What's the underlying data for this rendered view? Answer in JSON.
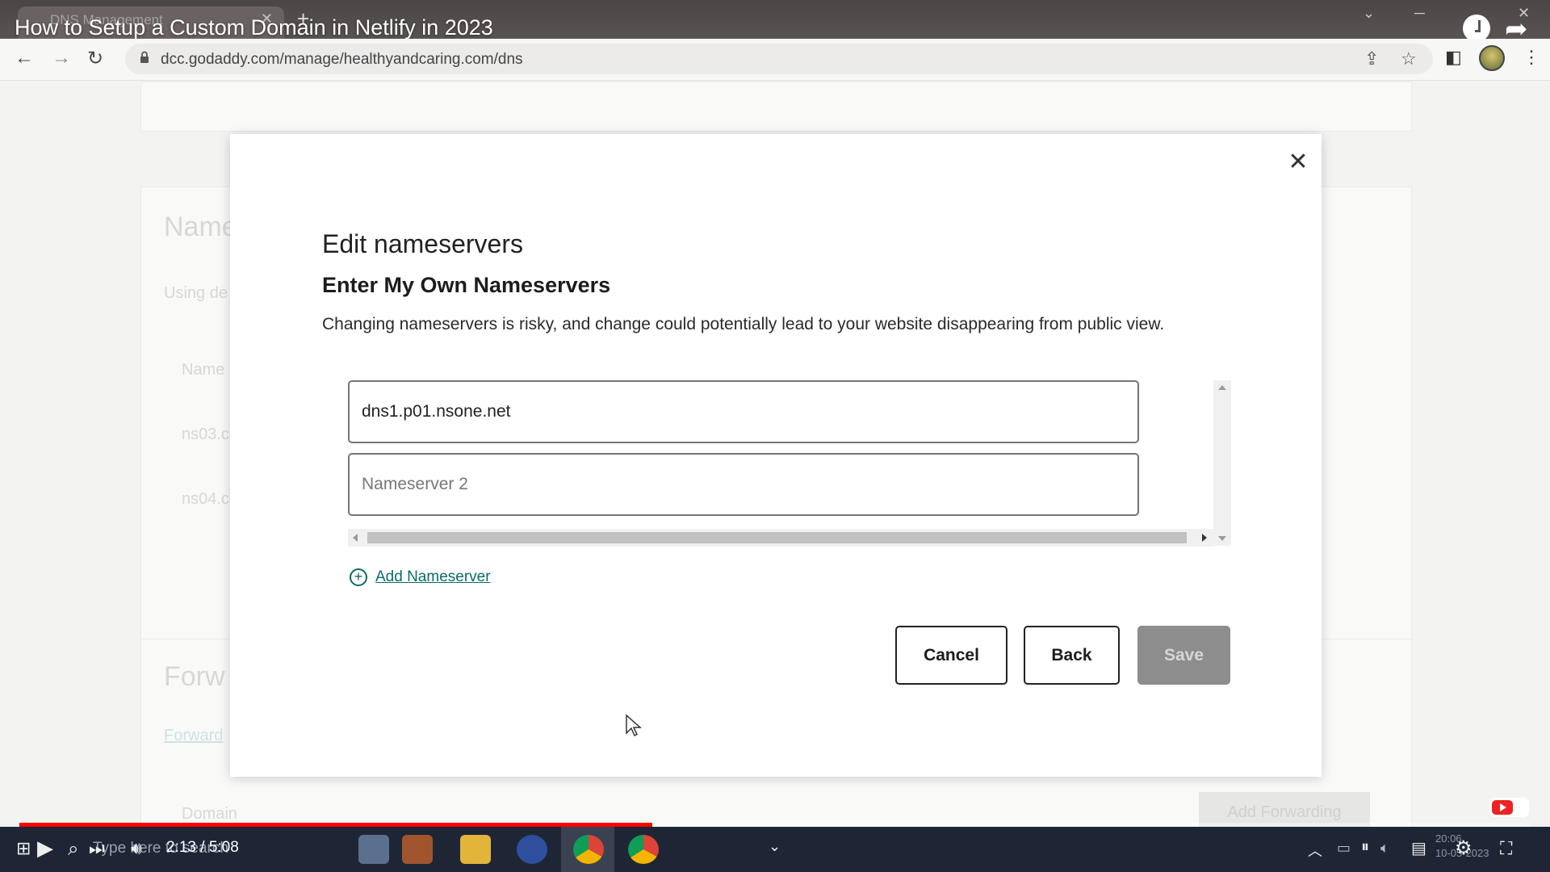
{
  "video": {
    "title": "How to Setup a Custom Domain in Netlify in 2023",
    "time": "2:13 / 5:08",
    "progress_fraction": 0.4186
  },
  "browser": {
    "tab_title": "DNS Management",
    "url": "dcc.godaddy.com/manage/healthyandcaring.com/dns"
  },
  "background_page": {
    "section1_heading": "Name",
    "section1_sub": "Using de",
    "col_name": "Name",
    "row1": "ns03.c",
    "row2": "ns04.c",
    "section2_heading": "Forw",
    "section2_link": "Forward",
    "domain_col": "Domain",
    "add_forwarding": "Add Forwarding"
  },
  "modal": {
    "title": "Edit nameservers",
    "subtitle": "Enter My Own Nameservers",
    "description": "Changing nameservers is risky, and change could potentially lead to your website disappearing from public view.",
    "nameserver1_value": "dns1.p01.nsone.net",
    "nameserver2_placeholder": "Nameserver 2",
    "add_nameserver_label": "Add Nameserver",
    "cancel_label": "Cancel",
    "back_label": "Back",
    "save_label": "Save"
  },
  "taskbar": {
    "search_placeholder": "Type here to search",
    "clock_time": "20:06",
    "clock_date": "10-05-2023"
  },
  "colors": {
    "accent_link": "#0b6b6b",
    "progress_played": "#ff0000",
    "save_disabled": "#8d8d8d"
  }
}
